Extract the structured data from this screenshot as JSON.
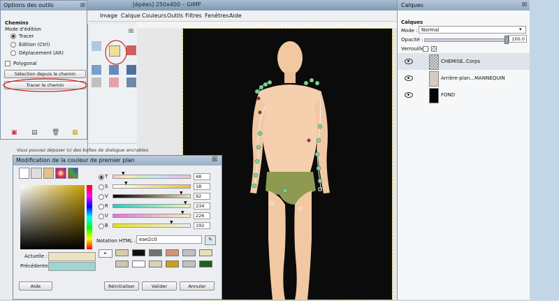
{
  "main_window": {
    "title": "[épées] 250x400 – GIMP",
    "menu": [
      "Image",
      "Calque",
      "Couleurs",
      "Outils",
      "Filtres",
      "Fenêtres",
      "Aide"
    ]
  },
  "tool_options": {
    "title": "Options des outils",
    "section": "Chemins",
    "mode_label": "Mode d'édition",
    "modes": [
      "Tracer",
      "Édition (Ctrl)",
      "Déplacement (Alt)"
    ],
    "polygonal": "Polygonal",
    "btn_selection": "Sélection depuis le chemin",
    "btn_trace": "Tracer le chemin"
  },
  "toolbox": {
    "hint": "Vous pouvez déposer ici des boîtes de dialogue ancrables."
  },
  "color_dialog": {
    "title": "Modification de la couleur de premier plan",
    "sliders": [
      {
        "label": "T",
        "value": "48",
        "grad": "linear-gradient(90deg,#f5c5c5,#f5f0b0,#c5f0c5,#c5e5f5,#e0c5f5,#f5c5c5)",
        "pos": 0.15
      },
      {
        "label": "S",
        "value": "18",
        "grad": "linear-gradient(90deg,#ffffff,#f0c030)",
        "pos": 0.18
      },
      {
        "label": "V",
        "value": "92",
        "grad": "linear-gradient(90deg,#000000,#f0e0b0)",
        "pos": 0.86
      },
      {
        "label": "R",
        "value": "234",
        "grad": "linear-gradient(90deg,#20d0c0,#f0f0c0)",
        "pos": 0.92
      },
      {
        "label": "V",
        "value": "226",
        "grad": "linear-gradient(90deg,#e070e0,#f0f0c0)",
        "pos": 0.88
      },
      {
        "label": "B",
        "value": "192",
        "grad": "linear-gradient(90deg,#e8e020,#f0f0f0)",
        "pos": 0.75
      }
    ],
    "html_label": "Notation HTML :",
    "html_value": "eae2c0",
    "current_label": "Actuelle :",
    "previous_label": "Précédente :",
    "current_color": "#eae2c0",
    "previous_color": "#9fd6d2",
    "history_colors": [
      "#d7cda6",
      "#101010",
      "#707070",
      "#d29478",
      "#c0c0c0",
      "#e6e0b8",
      "#cbc6b0",
      "#ffffff",
      "#d8d2b2",
      "#c6a020",
      "#c0c0c0",
      "#1f5f1c"
    ],
    "btn_help": "Aide",
    "btn_reset": "Réinitialiser",
    "btn_ok": "Valider",
    "btn_cancel": "Annuler"
  },
  "layers": {
    "title": "Calques",
    "section": "Calques",
    "mode_label": "Mode :",
    "mode_value": "Normal",
    "opacity_label": "Opacité :",
    "opacity_value": "100.0",
    "lock_label": "Verrouiller :",
    "items": [
      {
        "name": "CHEMISE..Corps",
        "selected": true
      },
      {
        "name": "Arrière-plan...MANNEQUIN",
        "selected": false
      },
      {
        "name": "FOND",
        "selected": false
      }
    ]
  }
}
